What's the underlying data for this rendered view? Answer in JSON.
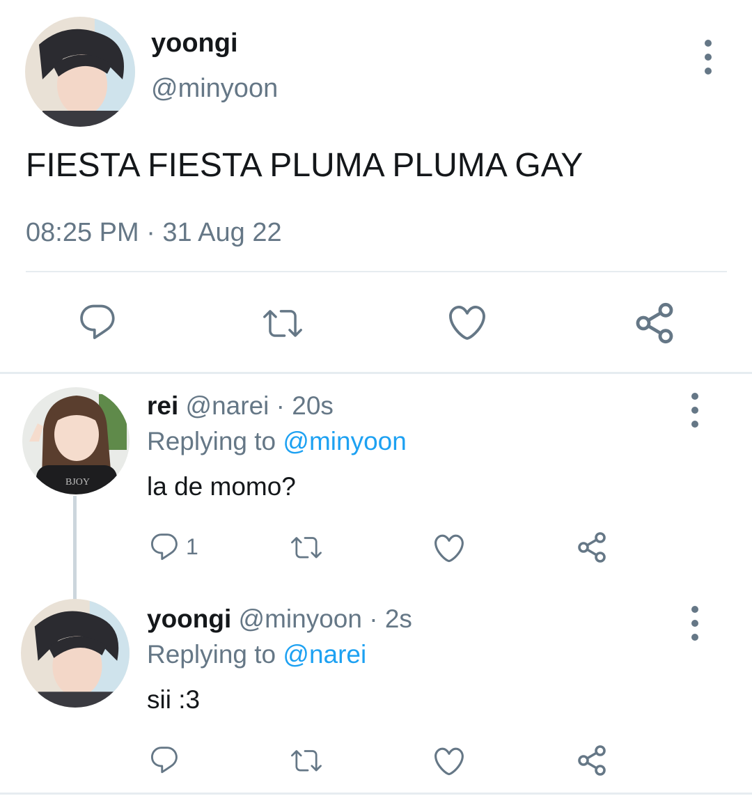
{
  "tweet": {
    "author_name": "yoongi",
    "author_handle": "@minyoon",
    "text": "FIESTA FIESTA PLUMA PLUMA GAY",
    "timestamp": "08:25 PM · 31 Aug 22"
  },
  "replies": [
    {
      "name": "rei",
      "handle": "@narei",
      "time": "· 20s",
      "replying_prefix": "Replying to",
      "replying_to": "@minyoon",
      "text": "la de momo?",
      "reply_count": "1",
      "shirt_text": "BJOY"
    },
    {
      "name": "yoongi",
      "handle": "@minyoon",
      "time": "· 2s",
      "replying_prefix": "Replying to",
      "replying_to": "@narei",
      "text": "sii :3"
    }
  ],
  "icons": [
    "more-vertical-icon",
    "reply-icon",
    "retweet-icon",
    "like-icon",
    "share-icon"
  ],
  "colors": {
    "text": "#14171a",
    "secondary": "#657786",
    "link": "#1da1f2",
    "divider": "#e6ecf0",
    "icon": "#657786"
  }
}
